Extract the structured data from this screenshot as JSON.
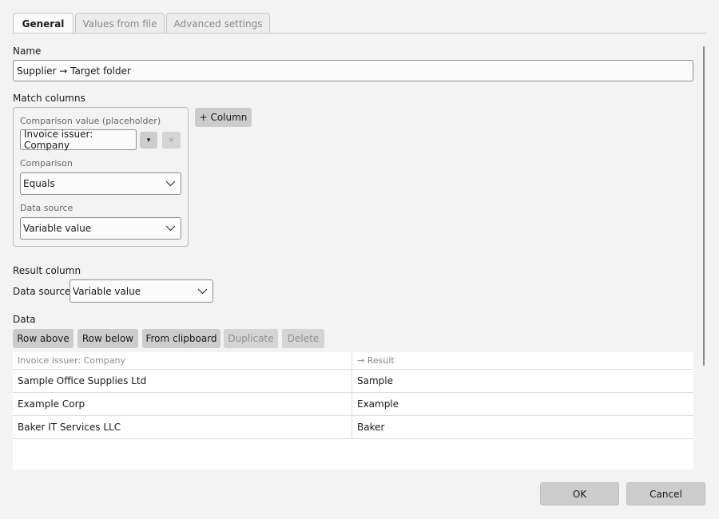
{
  "tabs": [
    "General",
    "Values from file",
    "Advanced settings"
  ],
  "name": {
    "label": "Name",
    "value": "Supplier → Target folder"
  },
  "match_columns": {
    "label": "Match columns",
    "comparison_value_label": "Comparison value (placeholder)",
    "comparison_value": "Invoice issuer: Company",
    "dropdown_glyph": "▾",
    "remove_glyph": "×",
    "comparison_label": "Comparison",
    "comparison": "Equals",
    "data_source_label": "Data source",
    "data_source": "Variable value",
    "add_column": "+ Column"
  },
  "result_column": {
    "label": "Result column",
    "data_source_label": "Data source",
    "data_source": "Variable value"
  },
  "data": {
    "label": "Data",
    "buttons": [
      "Row above",
      "Row below",
      "From clipboard",
      "Duplicate",
      "Delete"
    ],
    "headers": [
      "Invoice issuer: Company",
      "→ Result"
    ],
    "rows": [
      [
        "Sample Office Supplies Ltd",
        "Sample"
      ],
      [
        "Example Corp",
        "Example"
      ],
      [
        "Baker IT Services LLC",
        "Baker"
      ]
    ]
  },
  "footer": {
    "ok": "OK",
    "cancel": "Cancel"
  }
}
